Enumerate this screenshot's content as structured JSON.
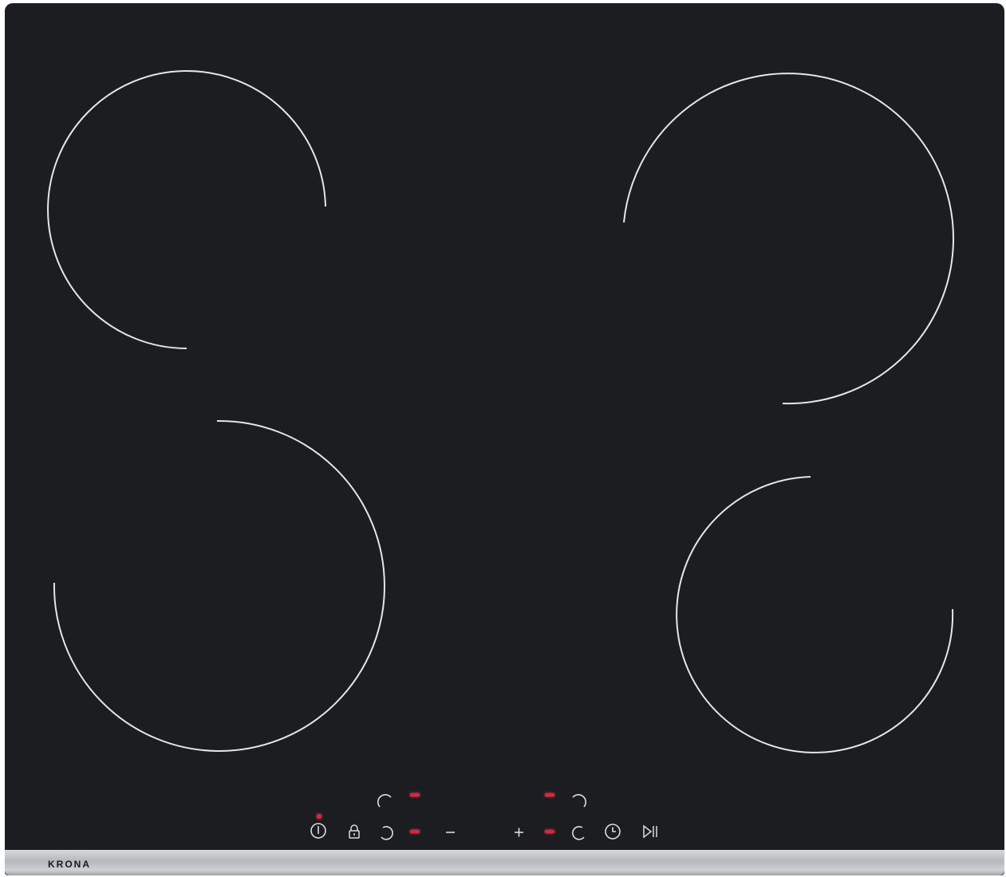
{
  "brand": {
    "name": "KRONA"
  },
  "colors": {
    "glass": "#1c1d20",
    "zone_outline": "#e6e6e6",
    "indicator": "#e0243e",
    "trim": "#c5c6c9"
  },
  "controls": {
    "power_icon": "power-icon",
    "lock_icon": "lock-icon",
    "minus_icon": "minus-icon",
    "plus_icon": "plus-icon",
    "timer_icon": "clock-icon",
    "pause_icon": "play-pause-icon"
  }
}
